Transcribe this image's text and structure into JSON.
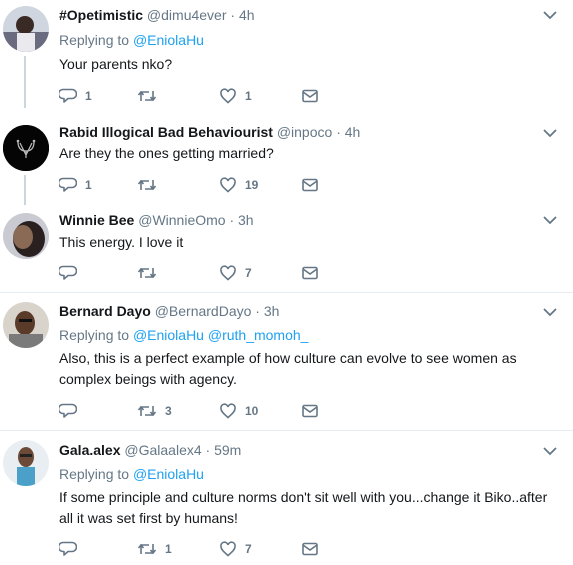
{
  "colors": {
    "link": "#1da1f2",
    "muted": "#657786",
    "text": "#14171a",
    "divider": "#e6ecf0"
  },
  "tweets": [
    {
      "name": "#Opetimistic",
      "handle": "@dimu4ever",
      "time": "· 4h",
      "replying_prefix": "Replying to ",
      "replying_to": [
        "@EniolaHu"
      ],
      "text": "Your parents nko?",
      "replies": "1",
      "retweets": "",
      "likes": "1"
    },
    {
      "name": "Rabid Illogical Bad Behaviourist",
      "handle": "@inpoco",
      "time": "· 4h",
      "text": "Are they the ones getting married?",
      "replies": "1",
      "retweets": "",
      "likes": "19"
    },
    {
      "name": "Winnie Bee",
      "handle": "@WinnieOmo",
      "time": "· 3h",
      "text": "This energy. I love it",
      "replies": "",
      "retweets": "",
      "likes": "7"
    },
    {
      "name": "Bernard Dayo",
      "handle": "@BernardDayo",
      "time": "· 3h",
      "replying_prefix": "Replying to ",
      "replying_to": [
        "@EniolaHu",
        "@ruth_momoh_"
      ],
      "text": "Also, this is a perfect example of how culture can evolve to see women as complex beings with agency.",
      "replies": "",
      "retweets": "3",
      "likes": "10"
    },
    {
      "name": "Gala.alex",
      "handle": "@Galaalex4",
      "time": "· 59m",
      "replying_prefix": "Replying to ",
      "replying_to": [
        "@EniolaHu"
      ],
      "text": "If some principle and culture norms don't sit well with you...change it Biko..after all it was set first by humans!",
      "replies": "",
      "retweets": "1",
      "likes": "7"
    }
  ],
  "icons": {
    "reply": "reply-icon",
    "retweet": "retweet-icon",
    "like": "heart-icon",
    "dm": "envelope-icon",
    "more": "chevron-down-icon"
  }
}
